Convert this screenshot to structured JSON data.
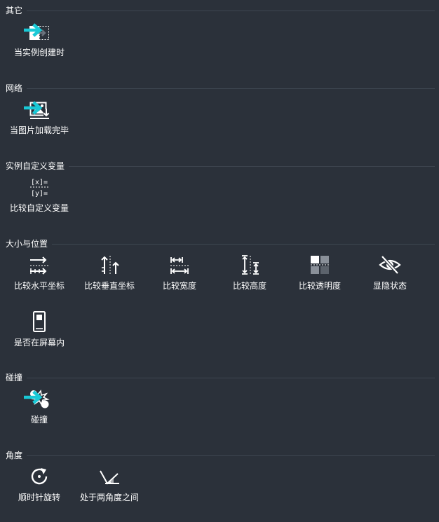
{
  "colors": {
    "background": "#2b313a",
    "divider": "#3e4650",
    "trigger_arrow": "#19c9d6",
    "icon": "#ffffff"
  },
  "sections": [
    {
      "title": "其它",
      "items": [
        {
          "label": "当实例创建时",
          "icon": "instance-created-icon",
          "trigger": true
        }
      ]
    },
    {
      "title": "网络",
      "items": [
        {
          "label": "当图片加载完毕",
          "icon": "image-loaded-icon",
          "trigger": true
        }
      ]
    },
    {
      "title": "实例自定义变量",
      "items": [
        {
          "label": "比较自定义变量",
          "icon": "compare-variable-icon",
          "trigger": false
        }
      ]
    },
    {
      "title": "大小与位置",
      "items": [
        {
          "label": "比较水平坐标",
          "icon": "compare-x-icon",
          "trigger": false
        },
        {
          "label": "比较垂直坐标",
          "icon": "compare-y-icon",
          "trigger": false
        },
        {
          "label": "比较宽度",
          "icon": "compare-width-icon",
          "trigger": false
        },
        {
          "label": "比较高度",
          "icon": "compare-height-icon",
          "trigger": false
        },
        {
          "label": "比较透明度",
          "icon": "compare-opacity-icon",
          "trigger": false
        },
        {
          "label": "显隐状态",
          "icon": "visibility-icon",
          "trigger": false
        },
        {
          "label": "是否在屏幕内",
          "icon": "on-screen-icon",
          "trigger": false
        }
      ]
    },
    {
      "title": "碰撞",
      "items": [
        {
          "label": "碰撞",
          "icon": "collision-icon",
          "trigger": true
        }
      ]
    },
    {
      "title": "角度",
      "items": [
        {
          "label": "顺时针旋转",
          "icon": "rotate-clockwise-icon",
          "trigger": false
        },
        {
          "label": "处于两角度之间",
          "icon": "angle-between-icon",
          "trigger": false
        }
      ]
    }
  ]
}
